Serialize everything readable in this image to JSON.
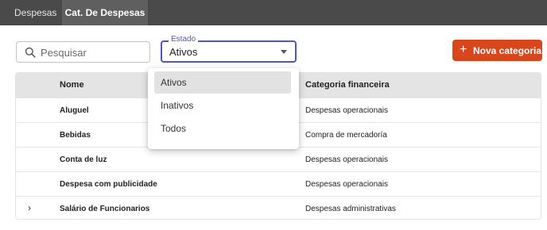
{
  "tabs": [
    {
      "label": "Despesas"
    },
    {
      "label": "Cat. De Despesas"
    }
  ],
  "search": {
    "placeholder": "Pesquisar",
    "value": ""
  },
  "estado_select": {
    "label": "Estado",
    "value": "Ativos"
  },
  "new_button": {
    "label": "Nova categoria",
    "icon": "plus-icon"
  },
  "table": {
    "headers": {
      "nome": "Nome",
      "categoria": "Categoria financeira"
    },
    "rows": [
      {
        "nome": "Aluguel",
        "categoria": "Despesas operacionais"
      },
      {
        "nome": "Bebidas",
        "categoria": "Compra de mercadoría"
      },
      {
        "nome": "Conta de luz",
        "categoria": "Despesas operacionais"
      },
      {
        "nome": "Despesa com publicidade",
        "categoria": "Despesas operacionais"
      },
      {
        "nome": "Salário de Funcionarios",
        "categoria": "Despesas administrativas",
        "expandable": true
      }
    ]
  },
  "dropdown": {
    "options": [
      {
        "label": "Ativos",
        "selected": true
      },
      {
        "label": "Inativos"
      },
      {
        "label": "Todos"
      }
    ]
  },
  "colors": {
    "accent": "#d8461b",
    "focus": "#4f55c9",
    "topbar": "#4a4a4a"
  }
}
